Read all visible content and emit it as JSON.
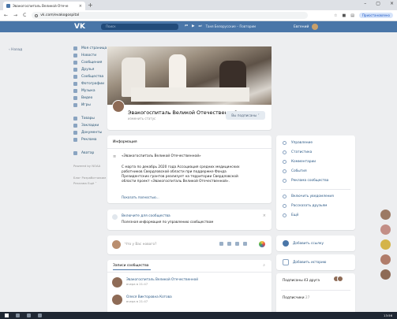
{
  "browser": {
    "tab_title": "Эвакогоспиталь Великой Отече",
    "tab_close": "×",
    "new_tab": "+",
    "url": "vk.com/evakogospital",
    "paused_label": "Приостановлено",
    "win_min": "–",
    "win_max": "▢",
    "win_close": "×",
    "nav_back": "←",
    "nav_forward": "→",
    "nav_reload": "C"
  },
  "vk": {
    "logo": "VK",
    "search_placeholder": "Поиск",
    "player_prev": "⏮",
    "player_play": "▶",
    "player_next": "⏭",
    "player_track": "Таня Белорусские – Повторим",
    "user_name": "Евгений"
  },
  "left_nav": {
    "back_label": "‹ Назад",
    "items": [
      {
        "label": "Моя страница"
      },
      {
        "label": "Новости"
      },
      {
        "label": "Сообщения"
      },
      {
        "label": "Друзья"
      },
      {
        "label": "Сообщества"
      },
      {
        "label": "Фотографии"
      },
      {
        "label": "Музыка"
      },
      {
        "label": "Видео"
      },
      {
        "label": "Игры"
      }
    ],
    "items2": [
      {
        "label": "Товары"
      },
      {
        "label": "Закладки"
      },
      {
        "label": "Документы"
      },
      {
        "label": "Реклама"
      }
    ],
    "avatar_label": "Аватар",
    "powered": "Powered by NOAA",
    "footer1": "Блог  Разработчикам",
    "footer2": "Реклама  Ещё ˅"
  },
  "group": {
    "name": "Эвакогоспиталь Великой Отечественной",
    "status": "изменить статус",
    "subscribe_button": "Вы подписаны ˅"
  },
  "info": {
    "header": "Информация",
    "quote": "«Эвакогоспиталь Великой Отечественной»",
    "body": "С марта по декабрь 2020 года Ассоциация средних медицинских работников Свердловской области при поддержке Фонда Президентских грантов реализует на территории Свердловской области проект «Эвакогоспиталь Великой Отечественной».",
    "more": "Показать полностью..."
  },
  "notif": {
    "title": "Включите для сообщества",
    "text": "Полезная информация по управлению сообществом",
    "close": "×"
  },
  "composer": {
    "placeholder": "Что у Вас нового?"
  },
  "wall": {
    "tab": "Записи сообщества",
    "search": "⌕",
    "posts": [
      {
        "name": "Эвакогоспиталь Великой Отечественной",
        "date": "вчера в 21:47"
      },
      {
        "name": "Олеся Викторовна Котова",
        "date": "вчера в 21:47"
      }
    ]
  },
  "right_menu": {
    "items": [
      {
        "label": "Управление"
      },
      {
        "label": "Статистика"
      },
      {
        "label": "Комментарии"
      },
      {
        "label": "События"
      },
      {
        "label": "Реклама сообщества"
      }
    ],
    "items2": [
      {
        "label": "Включить уведомления"
      },
      {
        "label": "Рассказать друзьям"
      },
      {
        "label": "Ещё"
      }
    ]
  },
  "right_boxes": {
    "add_link": "Добавить ссылку",
    "add_stories": "Добавить историю",
    "friends_subscribed": "Подписаны 43 друга",
    "subscribers": "Подписчики",
    "subscribers_count": "27"
  },
  "taskbar": {
    "clock": "13:56"
  },
  "colors": {
    "vk_blue": "#4a76a8",
    "link": "#2a5885",
    "page_bg": "#edeef0"
  }
}
